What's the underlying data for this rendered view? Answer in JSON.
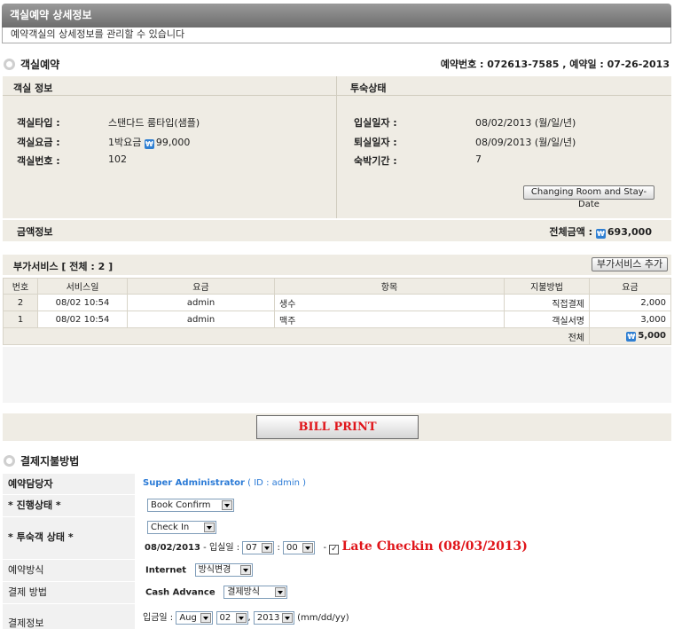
{
  "header": {
    "title": "객실예약 상세정보",
    "subtitle": "예약객실의 상세정보를 관리할 수 있습니다"
  },
  "reservation": {
    "section_title": "객실예약",
    "info": "예약번호 : 072613-7585 , 예약일 : 07-26-2013"
  },
  "room_info": {
    "title": "객실 정보",
    "type_label": "객실타입 :",
    "type_value": "스탠다드 룸타입(샘플)",
    "rate_label": "객실요금 :",
    "rate_value_prefix": "1박요금",
    "rate_value": "99,000",
    "number_label": "객실번호 :",
    "number_value": "102"
  },
  "stay_status": {
    "title": "투숙상태",
    "checkin_label": "입실일자 :",
    "checkin_value": "08/02/2013 (월/일/년)",
    "checkout_label": "퇴실일자 :",
    "checkout_value": "08/09/2013 (월/일/년)",
    "nights_label": "숙박기간 :",
    "nights_value": "7",
    "change_button": "Changing Room and Stay-Date"
  },
  "amount": {
    "label": "금액정보",
    "total_label": "전체금액 :",
    "total_value": "693,000"
  },
  "services": {
    "title": "부가서비스 [ 전체 : 2 ]",
    "add_button": "부가서비스 추가",
    "columns": [
      "번호",
      "서비스일",
      "요금",
      "항목",
      "지불방법",
      "요금"
    ],
    "rows": [
      {
        "no": "2",
        "date": "08/02 10:54",
        "by": "admin",
        "item": "생수",
        "method": "직접결제",
        "amount": "2,000"
      },
      {
        "no": "1",
        "date": "08/02 10:54",
        "by": "admin",
        "item": "맥주",
        "method": "객실서명",
        "amount": "3,000"
      }
    ],
    "total_label": "전체",
    "total_value": "5,000"
  },
  "bill_button": "BILL PRINT",
  "payment": {
    "section_title": "결제지불방법",
    "staff_label": "예약담당자",
    "staff_name": "Super Administrator",
    "staff_id": "( ID : admin )",
    "progress_label": "* 진행상태 *",
    "progress_value": "Book Confirm",
    "guest_label": "* 투숙객 상태 *",
    "guest_value": "Check In",
    "checkin_date": "08/02/2013",
    "checkin_time_label": "- 입실일 :",
    "hour": "07",
    "minute": "00",
    "late_checkin": "Late Checkin (08/03/2013)",
    "method_label": "예약방식",
    "method_value": "Internet",
    "method_select": "방식변경",
    "pay_label": "결제 방법",
    "pay_value": "Cash Advance",
    "pay_select": "결제방식",
    "info_label": "결제정보",
    "deposit_label": "입금일 :",
    "month": "Aug",
    "day": "02",
    "year": "2013",
    "date_format": "(mm/dd/yy)"
  },
  "colors": {
    "panel": "#efece4",
    "accent_red": "#e0151a",
    "link_blue": "#2a7ad6"
  }
}
